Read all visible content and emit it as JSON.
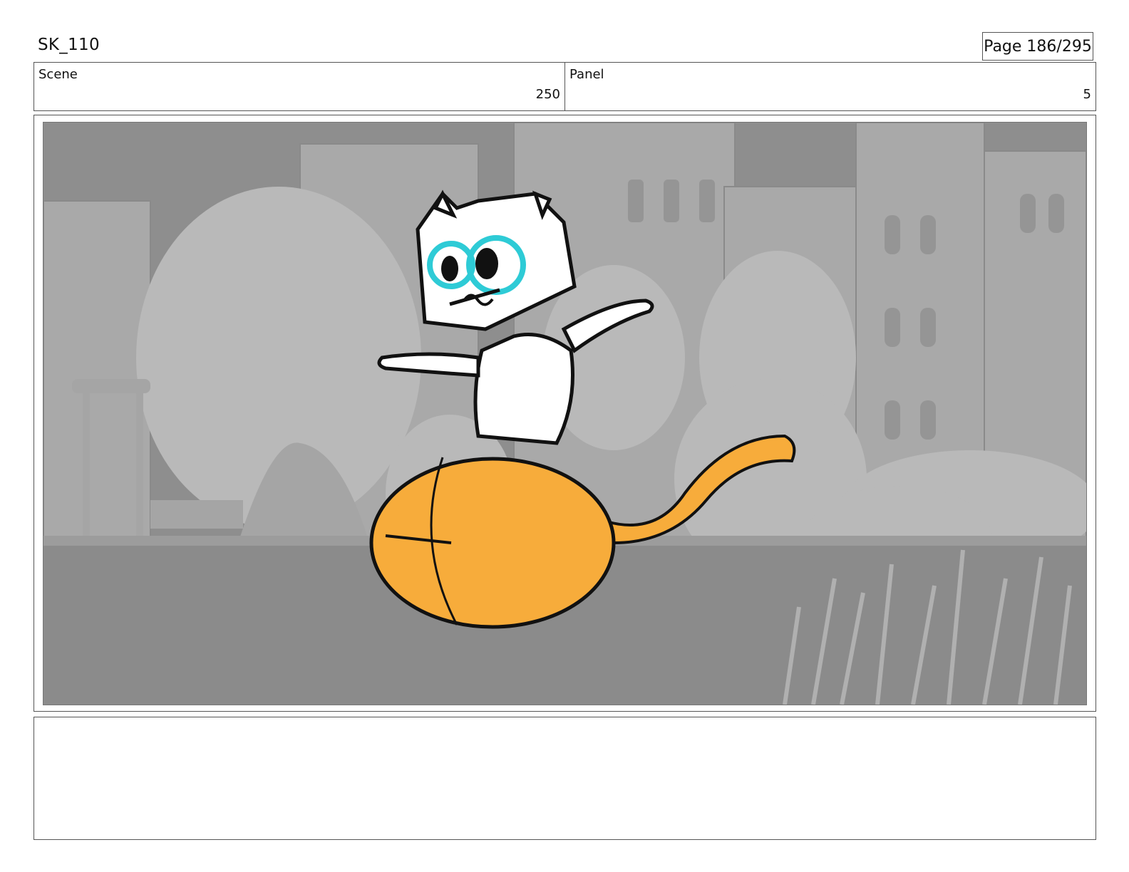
{
  "header": {
    "sheet_title": "SK_110",
    "page_indicator": "Page 186/295"
  },
  "info": {
    "scene_label": "Scene",
    "scene_value": "250",
    "panel_label": "Panel",
    "panel_value": "5"
  },
  "frame": {
    "icon": "storyboard-drawing-icon",
    "colors": {
      "sky": "#8e8e8e",
      "buildings": "#a9a9a9",
      "trees": "#b7b7b7",
      "ground": "#8b8b8b",
      "ball": "#f7ac3b",
      "eye_accent": "#2ecbd6"
    }
  },
  "notes": {
    "text": ""
  }
}
